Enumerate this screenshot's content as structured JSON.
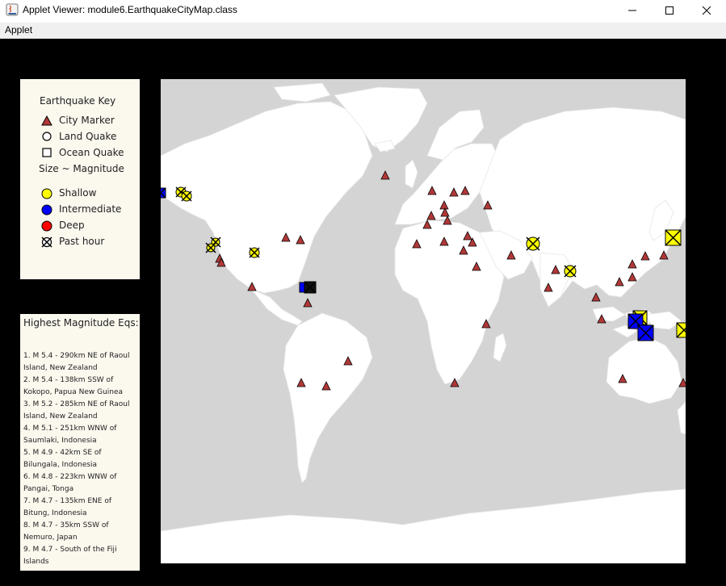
{
  "window": {
    "title": "Applet Viewer: module6.EarthquakeCityMap.class",
    "minimize_glyph": "—",
    "maximize_glyph": "☐",
    "close_glyph": "✕"
  },
  "menu": {
    "items": [
      {
        "label": "Applet"
      }
    ]
  },
  "key": {
    "title": "Earthquake Key",
    "items": [
      {
        "label": "City Marker",
        "icon": "triangle-icon"
      },
      {
        "label": "Land Quake",
        "icon": "circle-icon"
      },
      {
        "label": "Ocean Quake",
        "icon": "square-icon"
      }
    ],
    "size_label": "Size ~ Magnitude",
    "depth_items": [
      {
        "label": "Shallow",
        "color": "#ffff00"
      },
      {
        "label": "Intermediate",
        "color": "#0000ff"
      },
      {
        "label": "Deep",
        "color": "#ff0000"
      },
      {
        "label": "Past hour",
        "color": ""
      }
    ]
  },
  "highest": {
    "title": "Highest Magnitude Eqs:",
    "items": [
      "1. M 5.4 - 290km NE of Raoul Island, New Zealand",
      "2. M 5.4 - 138km SSW of Kokopo, Papua New Guinea",
      "3. M 5.2 - 285km NE of Raoul Island, New Zealand",
      "4. M 5.1 - 251km WNW of Saumlaki, Indonesia",
      "5. M 4.9 - 42km SE of Bilungala, Indonesia",
      "6. M 4.8 - 223km WNW of Pangai, Tonga",
      "7. M 4.7 - 135km ENE of Bitung, Indonesia",
      "8. M 4.7 - 35km SSW of Nemuro, Japan",
      "9. M 4.7 - South of the Fiji Islands"
    ]
  },
  "colors": {
    "city_marker": "#b13838",
    "shallow": "#ffff00",
    "intermediate": "#0000ff",
    "deep": "#ff0000",
    "ocean": "#d4d4d4",
    "land": "#ffffff",
    "panel": "#fbf8ee"
  }
}
